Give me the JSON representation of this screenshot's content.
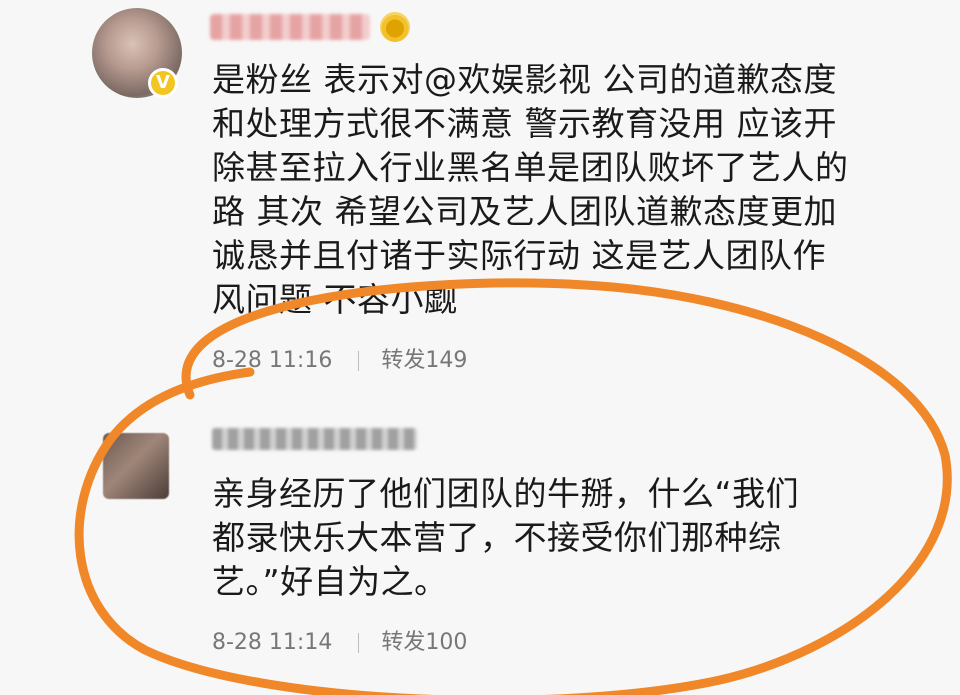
{
  "post1": {
    "text": "是粉丝 表示对@欢娱影视 公司的道歉态度\n和处理方式很不满意 警示教育没用 应该开\n除甚至拉入行业黑名单是团队败坏了艺人的\n路 其次 希望公司及艺人团队道歉态度更加\n诚恳并且付诸于实际行动  这是艺人团队作\n风问题 不容小觑",
    "time": "8-28 11:16",
    "repost": "转发149"
  },
  "post2": {
    "text": "亲身经历了他们团队的牛掰，什么“我们\n都录快乐大本营了，不接受你们那种综\n艺。”好自为之。",
    "time": "8-28 11:14",
    "repost": "转发100"
  },
  "highlight": {
    "color": "#f0882a"
  },
  "icons": {
    "verified_badge": "verified-v-icon"
  }
}
